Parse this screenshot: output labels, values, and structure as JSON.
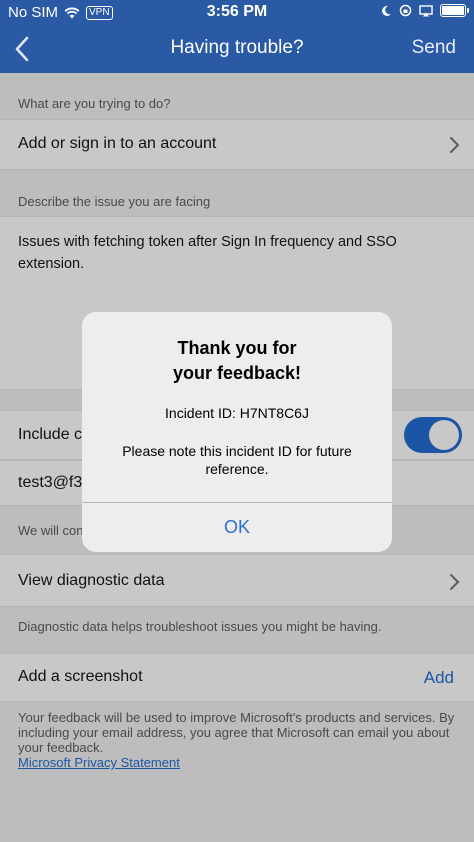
{
  "status_bar": {
    "carrier": "No SIM",
    "vpn": "VPN",
    "time": "3:56 PM",
    "battery_level": 0.9
  },
  "nav": {
    "title": "Having trouble?",
    "send": "Send"
  },
  "form": {
    "question_label": "What are you trying to do?",
    "question_value": "Add or sign in to an account",
    "issue_label": "Describe the issue you are facing",
    "issue_text": "Issues with fetching token after Sign In frequency and SSO extension.",
    "include_label_partial": "Include c",
    "include_toggle_on": true,
    "email_partial": "test3@f3",
    "contact_partial": "We will con",
    "diagnostic_label": "View diagnostic data",
    "diagnostic_help": "Diagnostic data helps troubleshoot issues you might be having.",
    "screenshot_label": "Add a screenshot",
    "screenshot_add": "Add",
    "footer_text": "Your feedback will be used to improve Microsoft's products and services. By including your email address, you agree that Microsoft can email you about your feedback.",
    "privacy_link": "Microsoft Privacy Statement"
  },
  "modal": {
    "title_line1": "Thank you for",
    "title_line2": "your feedback!",
    "incident": "Incident ID: H7NT8C6J",
    "note": "Please note this incident ID for future reference.",
    "ok": "OK"
  },
  "colors": {
    "nav_blue": "#2a5aa3",
    "accent_blue": "#1c55a5",
    "ok_blue": "#2d6fd3"
  }
}
